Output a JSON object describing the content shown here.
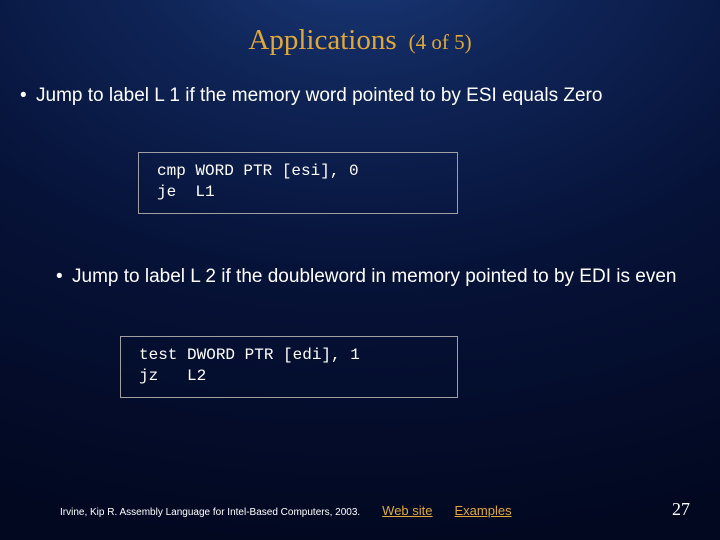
{
  "title": {
    "main": "Applications",
    "sub": "(4 of 5)"
  },
  "bullets": [
    "Jump to label L 1 if the memory word pointed to by ESI equals Zero",
    "Jump to label L 2 if the doubleword in memory pointed to by EDI is even"
  ],
  "code": [
    "cmp WORD PTR [esi], 0\nje  L1",
    "test DWORD PTR [edi], 1\njz   L2"
  ],
  "footer": {
    "citation": "Irvine, Kip R. Assembly Language for Intel-Based Computers, 2003.",
    "link1": "Web site",
    "link2": "Examples",
    "page": "27"
  }
}
